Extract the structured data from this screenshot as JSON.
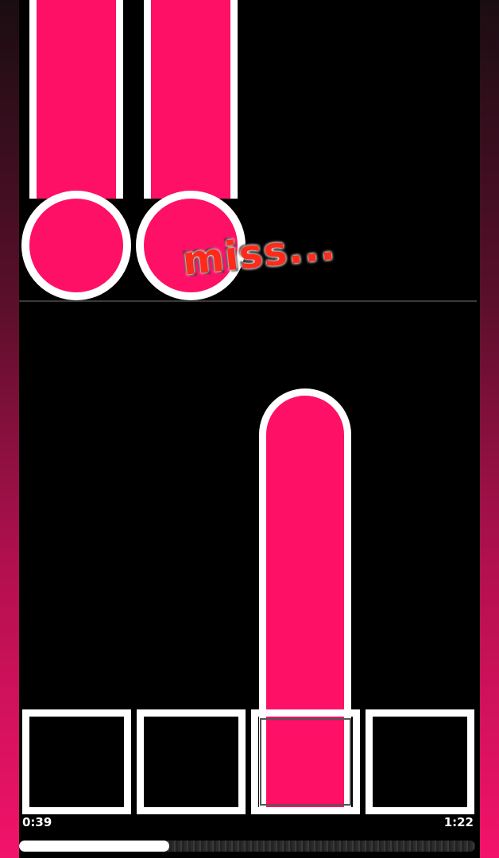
{
  "colors": {
    "note": "#fe1066",
    "note_outline": "#ffffff",
    "background": "#000000",
    "judgement_text": "#ff2a1a"
  },
  "judgement": {
    "text": "miss..."
  },
  "lanes": [
    {
      "index": 1,
      "held_note": true,
      "falling_note": false,
      "pressed": false
    },
    {
      "index": 2,
      "held_note": true,
      "falling_note": false,
      "pressed": false
    },
    {
      "index": 3,
      "held_note": false,
      "falling_note": true,
      "pressed": true
    },
    {
      "index": 4,
      "held_note": false,
      "falling_note": false,
      "pressed": false
    }
  ],
  "playback": {
    "elapsed": "0:39",
    "total": "1:22",
    "progress_fraction": 0.33
  }
}
